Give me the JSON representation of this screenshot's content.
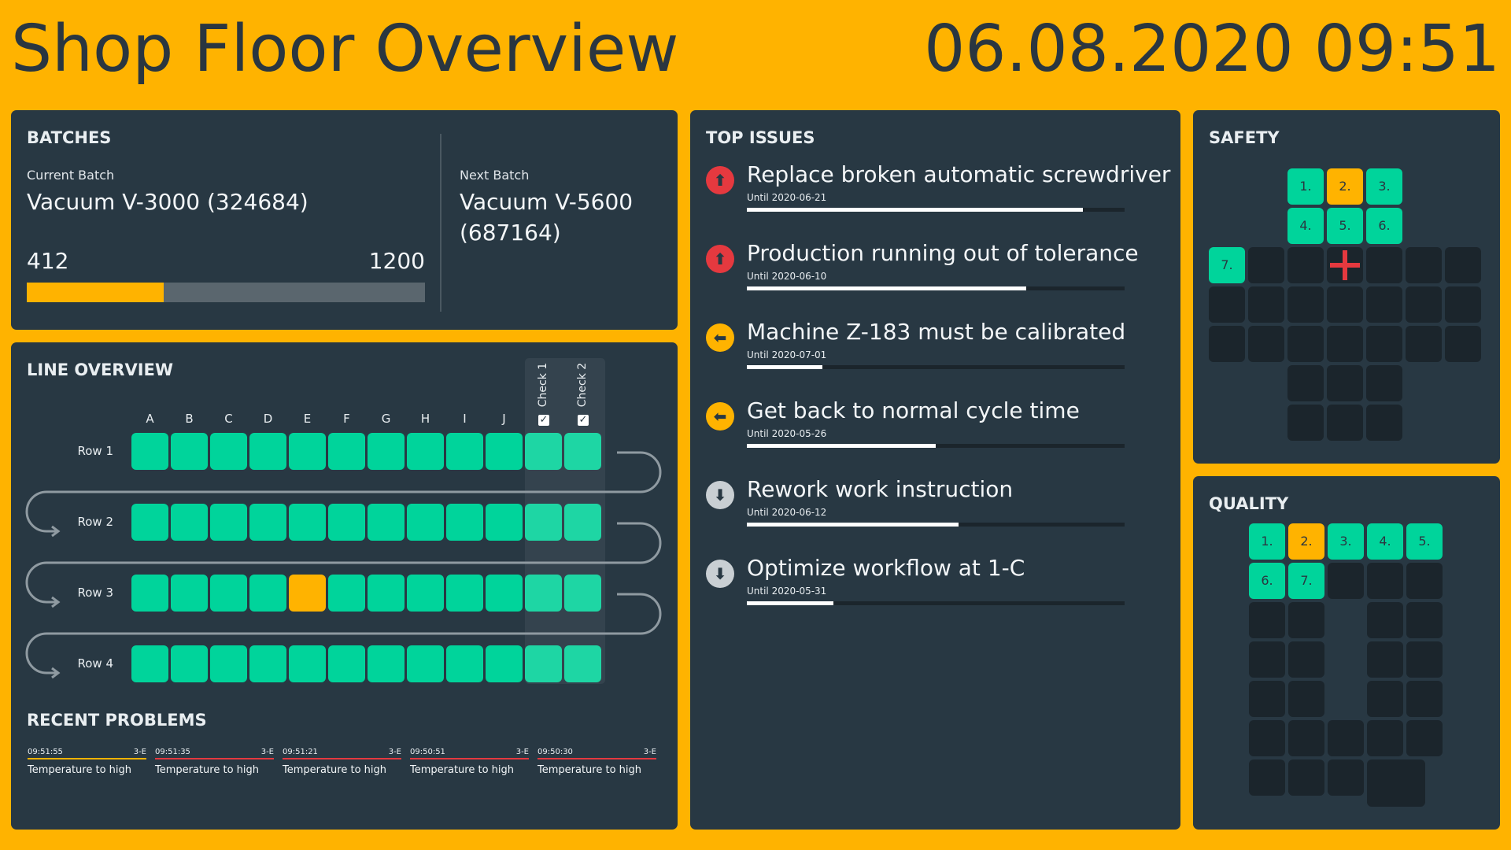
{
  "header": {
    "title": "Shop Floor Overview",
    "datetime": "06.08.2020 09:51"
  },
  "colors": {
    "background": "#FFB300",
    "panel": "#283843",
    "ok": "#00D49B",
    "warn": "#FFB300",
    "bad": "#E5393F",
    "neutral": "#8a949a",
    "empty": "#1b252c"
  },
  "batches": {
    "heading": "BATCHES",
    "current_label": "Current Batch",
    "current_name": "Vacuum V-3000 (324684)",
    "produced": "412",
    "target": "1200",
    "progress_fraction": 0.343,
    "next_label": "Next Batch",
    "next_name_line1": "Vacuum V-5600",
    "next_name_line2": "(687164)"
  },
  "line_overview": {
    "heading": "LINE OVERVIEW",
    "columns": [
      "A",
      "B",
      "C",
      "D",
      "E",
      "F",
      "G",
      "H",
      "I",
      "J"
    ],
    "check_columns": [
      "Check 1",
      "Check 2"
    ],
    "check_marks": [
      "✓",
      "✓"
    ],
    "rows": [
      {
        "label": "Row 1",
        "states": [
          "ok",
          "ok",
          "ok",
          "ok",
          "ok",
          "ok",
          "ok",
          "ok",
          "ok",
          "ok",
          "ok",
          "ok"
        ]
      },
      {
        "label": "Row 2",
        "states": [
          "ok",
          "ok",
          "ok",
          "ok",
          "ok",
          "ok",
          "ok",
          "ok",
          "ok",
          "ok",
          "ok",
          "ok"
        ]
      },
      {
        "label": "Row 3",
        "states": [
          "ok",
          "ok",
          "ok",
          "ok",
          "warn",
          "ok",
          "ok",
          "ok",
          "ok",
          "ok",
          "ok",
          "ok"
        ]
      },
      {
        "label": "Row 4",
        "states": [
          "ok",
          "ok",
          "ok",
          "ok",
          "ok",
          "ok",
          "ok",
          "ok",
          "ok",
          "ok",
          "ok",
          "ok"
        ]
      }
    ]
  },
  "recent_problems": {
    "heading": "RECENT PROBLEMS",
    "items": [
      {
        "time": "09:51:55",
        "station": "3-E",
        "text": "Temperature to high",
        "severity": "warn"
      },
      {
        "time": "09:51:35",
        "station": "3-E",
        "text": "Temperature to high",
        "severity": "bad"
      },
      {
        "time": "09:51:21",
        "station": "3-E",
        "text": "Temperature to high",
        "severity": "bad"
      },
      {
        "time": "09:50:51",
        "station": "3-E",
        "text": "Temperature to high",
        "severity": "bad"
      },
      {
        "time": "09:50:30",
        "station": "3-E",
        "text": "Temperature to high",
        "severity": "bad"
      }
    ]
  },
  "top_issues": {
    "heading": "TOP ISSUES",
    "items": [
      {
        "title": "Replace broken automatic screwdriver",
        "until": "Until  2020-06-21",
        "priority": "high",
        "icon": "arrow-up-icon",
        "glyph": "⬆",
        "progress": 0.89
      },
      {
        "title": "Production running out of tolerance",
        "until": "Until  2020-06-10",
        "priority": "high",
        "icon": "arrow-up-icon",
        "glyph": "⬆",
        "progress": 0.74
      },
      {
        "title": "Machine Z-183 must be calibrated",
        "until": "Until  2020-07-01",
        "priority": "medium",
        "icon": "arrow-left-icon",
        "glyph": "⬅",
        "progress": 0.2
      },
      {
        "title": "Get back to normal cycle time",
        "until": "Until  2020-05-26",
        "priority": "medium",
        "icon": "arrow-left-icon",
        "glyph": "⬅",
        "progress": 0.5
      },
      {
        "title": "Rework work instruction",
        "until": "Until  2020-06-12",
        "priority": "low",
        "icon": "arrow-down-icon",
        "glyph": "⬇",
        "progress": 0.56
      },
      {
        "title": "Optimize workflow at 1-C",
        "until": "Until  2020-05-31",
        "priority": "low",
        "icon": "arrow-down-icon",
        "glyph": "⬇",
        "progress": 0.23
      }
    ]
  },
  "safety": {
    "heading": "SAFETY",
    "cross_icon": "plus-icon",
    "day_labels": [
      "1.",
      "2.",
      "3.",
      "4.",
      "5.",
      "6.",
      "7."
    ],
    "day_states": [
      "ok",
      "warn",
      "ok",
      "ok",
      "ok",
      "ok",
      "ok"
    ]
  },
  "quality": {
    "heading": "QUALITY",
    "day_labels": [
      "1.",
      "2.",
      "3.",
      "4.",
      "5.",
      "6.",
      "7."
    ],
    "day_states": [
      "ok",
      "warn",
      "ok",
      "ok",
      "ok",
      "ok",
      "ok"
    ]
  }
}
